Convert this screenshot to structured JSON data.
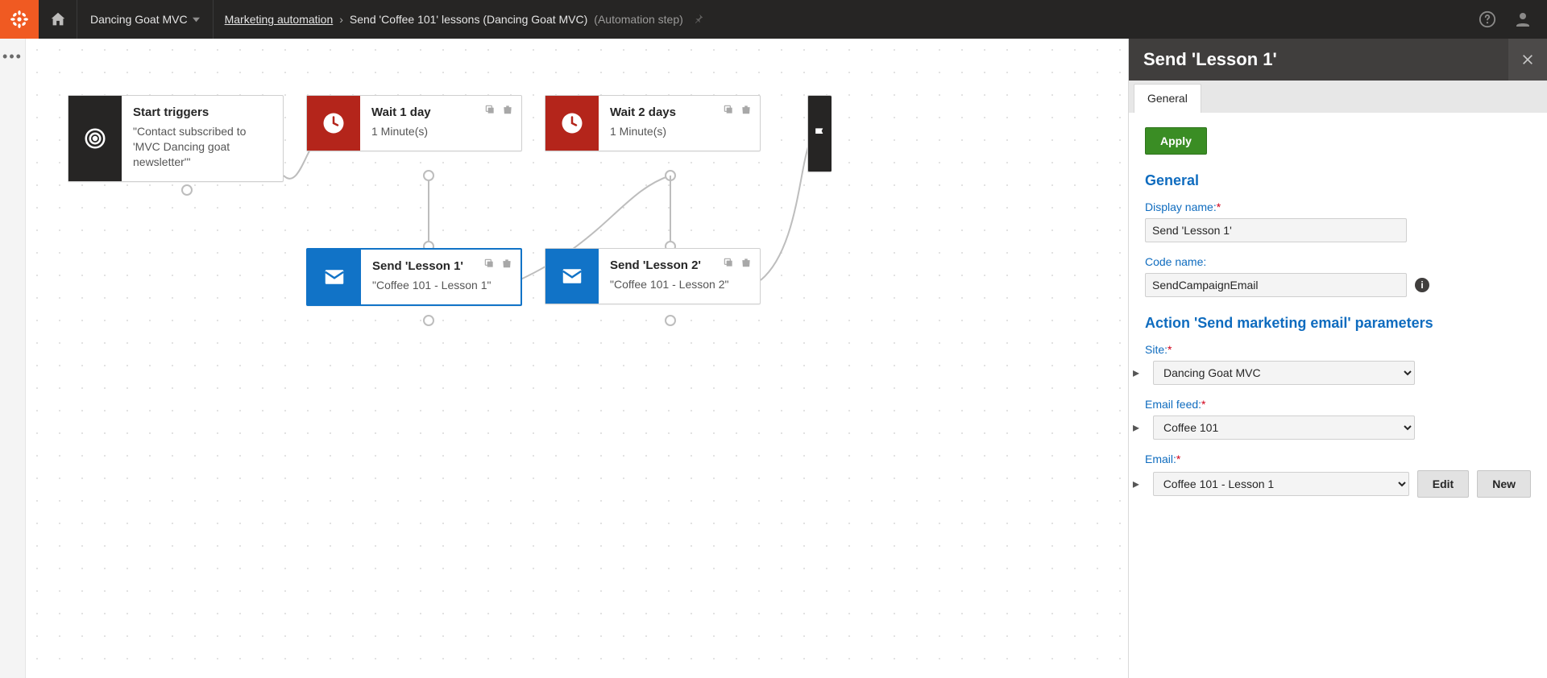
{
  "topbar": {
    "site_name": "Dancing Goat MVC",
    "crumb_app": "Marketing automation",
    "crumb_item": "Send 'Coffee 101' lessons (Dancing Goat MVC)",
    "crumb_suffix": "(Automation step)"
  },
  "nodes": {
    "start": {
      "title": "Start triggers",
      "sub": "\"Contact subscribed to 'MVC Dancing goat newsletter'\""
    },
    "wait1": {
      "title": "Wait 1 day",
      "sub": "1 Minute(s)"
    },
    "wait2": {
      "title": "Wait 2 days",
      "sub": "1 Minute(s)"
    },
    "send1": {
      "title": "Send 'Lesson 1'",
      "sub": "\"Coffee 101 - Lesson 1\""
    },
    "send2": {
      "title": "Send 'Lesson 2'",
      "sub": "\"Coffee 101 - Lesson 2\""
    }
  },
  "panel": {
    "title": "Send 'Lesson 1'",
    "tab_general": "General",
    "apply": "Apply",
    "section_general": "General",
    "label_display_name": "Display name:",
    "value_display_name": "Send 'Lesson 1'",
    "label_code_name": "Code name:",
    "value_code_name": "SendCampaignEmail",
    "section_action": "Action 'Send marketing email' parameters",
    "label_site": "Site:",
    "value_site": "Dancing Goat MVC",
    "label_email_feed": "Email feed:",
    "value_email_feed": "Coffee 101",
    "label_email": "Email:",
    "value_email": "Coffee 101 - Lesson 1",
    "btn_edit": "Edit",
    "btn_new": "New"
  }
}
